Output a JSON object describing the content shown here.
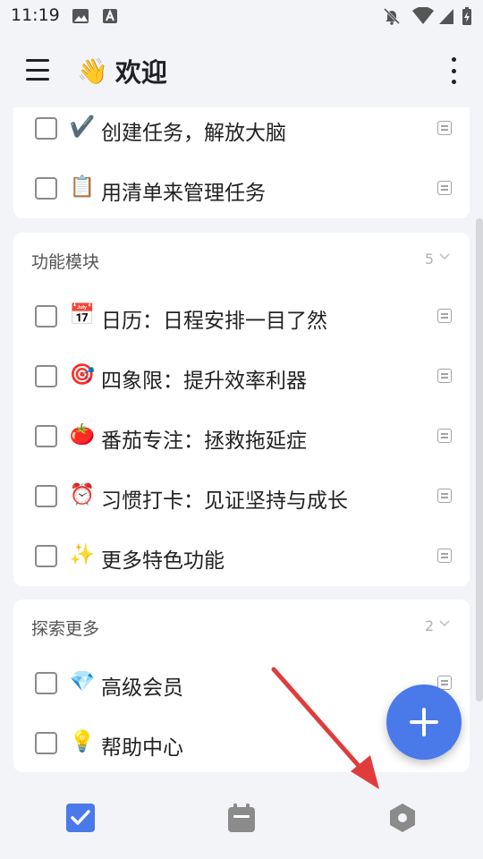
{
  "status_bar": {
    "time": "11:19",
    "icons": [
      "image-icon",
      "a-box-icon",
      "notifications-off-icon",
      "wifi-icon",
      "signal-icon",
      "battery-charging-icon"
    ]
  },
  "app_bar": {
    "menu_icon": "hamburger-menu-icon",
    "title_emoji": "👋",
    "title": "欢迎",
    "more_icon": "more-vertical-icon"
  },
  "sections": [
    {
      "id": "intro",
      "tasks": [
        {
          "emoji": "✔️",
          "text": "创建任务，解放大脑"
        },
        {
          "emoji": "📋",
          "text": "用清单来管理任务"
        }
      ]
    },
    {
      "id": "features",
      "title": "功能模块",
      "count": "5",
      "tasks": [
        {
          "emoji": "📅",
          "text": "日历：日程安排一目了然"
        },
        {
          "emoji": "🎯",
          "text": "四象限：提升效率利器"
        },
        {
          "emoji": "🍅",
          "text": "番茄专注：拯救拖延症"
        },
        {
          "emoji": "⏰",
          "text": "习惯打卡：见证坚持与成长"
        },
        {
          "emoji": "✨",
          "text": "更多特色功能"
        }
      ]
    },
    {
      "id": "explore",
      "title": "探索更多",
      "count": "2",
      "tasks": [
        {
          "emoji": "💎",
          "text": "高级会员"
        },
        {
          "emoji": "💡",
          "text": "帮助中心"
        }
      ]
    }
  ],
  "fab": {
    "icon": "plus-icon"
  },
  "bottom_nav": [
    {
      "icon": "checkbox-tasks-icon",
      "active": true
    },
    {
      "icon": "calendar-icon",
      "active": false
    },
    {
      "icon": "hexagon-settings-icon",
      "active": false
    }
  ],
  "colors": {
    "accent": "#4a79ea",
    "background": "#f3f4f8",
    "card": "#ffffff",
    "annotation_arrow": "#e03c3c"
  }
}
